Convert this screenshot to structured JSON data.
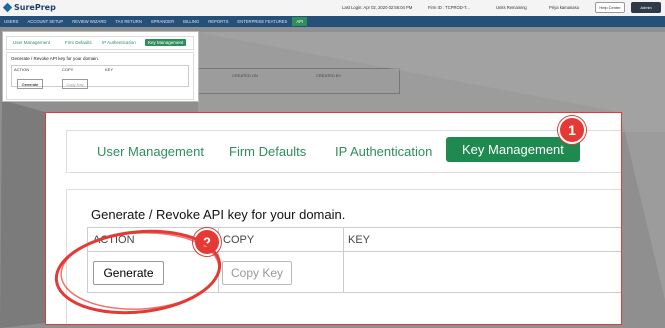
{
  "header": {
    "logo_text": "SurePrep",
    "last_login": "Last Login: Apr 02, 2020 02:56:04 PM",
    "firm": "Firm ID : TCPROD-T...",
    "units": "Units Remaining",
    "user": "Priya kamanasu",
    "help": "Help Center",
    "admin": "Admin"
  },
  "nav": {
    "items": [
      "Users",
      "Account Setup",
      "Review Wizard",
      "Tax Return",
      "SPRANDER",
      "Billing",
      "Reports",
      "Enterprise Features",
      "API"
    ],
    "active_index": 8
  },
  "background": {
    "columns": [
      "CREATED ON",
      "CREATED BY"
    ]
  },
  "mini": {
    "tabs": [
      "User Management",
      "Firm Defaults",
      "IP Authentication",
      "Key Management"
    ],
    "title": "Generate / Revoke API key for your domain.",
    "columns": [
      "ACTION",
      "COPY",
      "KEY"
    ],
    "generate": "Generate",
    "copy": "Copy Key"
  },
  "zoom": {
    "tabs": [
      "User Management",
      "Firm Defaults",
      "IP Authentication",
      "Key Management"
    ],
    "active_tab": "Key Management",
    "title": "Generate / Revoke API key for your domain.",
    "columns": [
      "ACTION",
      "COPY",
      "KEY"
    ],
    "generate": "Generate",
    "copy": "Copy Key"
  },
  "badges": {
    "one": "1",
    "two": "2"
  },
  "colors": {
    "accent_green": "#1e8a50",
    "nav_blue": "#24507a",
    "highlight_red": "#e53935"
  }
}
